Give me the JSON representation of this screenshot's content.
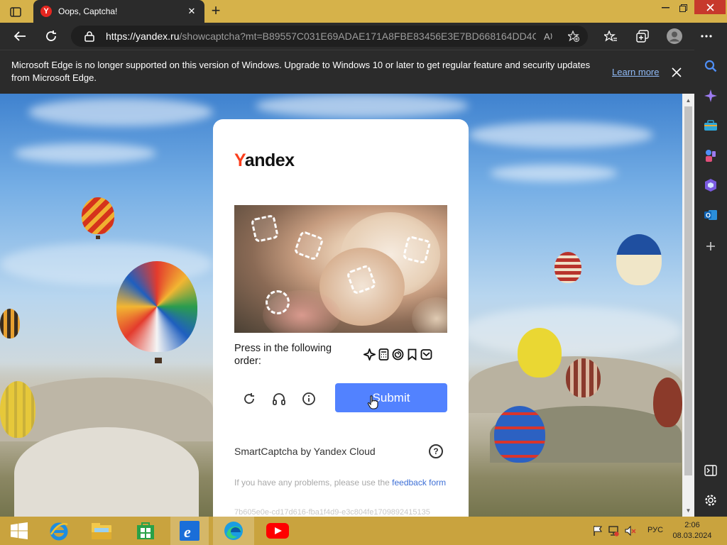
{
  "browser": {
    "tab_title": "Oops, Captcha!",
    "tab_close": "✕",
    "new_tab": "+",
    "url_domain": "https://yandex.ru",
    "url_path": "/showcaptcha?mt=B89557C031E69ADAE171A8FBE83456E3E7BD668164DD4CC...",
    "colors": {
      "titlebar": "#d6b24a",
      "chrome": "#2b2b2b",
      "close": "#c7392c"
    }
  },
  "notification": {
    "text": "Microsoft Edge is no longer supported on this version of Windows. Upgrade to Windows 10 or later to get regular feature and security updates from Microsoft Edge.",
    "link": "Learn more"
  },
  "captcha": {
    "logo_y": "Y",
    "logo_rest": "andex",
    "prompt": "Press in the following order:",
    "submit_label": "Submit",
    "brand": "SmartCaptcha by Yandex Cloud",
    "help": "?",
    "feedback_prefix": "If you have any problems, please use the ",
    "feedback_link": "feedback form",
    "hash": "7b605e0e-cd17d616-fba1f4d9-e3c804fe1709892415135",
    "colors": {
      "submit": "#5282ff",
      "logo_accent": "#fc3f1d"
    }
  },
  "taskbar": {
    "lang": "РУС",
    "time": "2:06",
    "date": "08.03.2024"
  }
}
